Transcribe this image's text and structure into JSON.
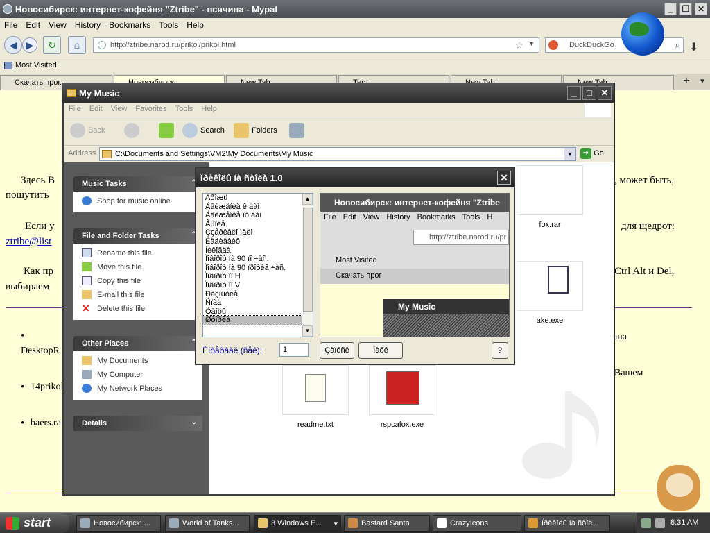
{
  "firefox": {
    "title": "Новосибирск: интернет-кофейня \"Ztribe\" - всячина - Mypal",
    "menu": [
      "File",
      "Edit",
      "View",
      "History",
      "Bookmarks",
      "Tools",
      "Help"
    ],
    "url": "http://ztribe.narod.ru/prikol/prikol.html",
    "search_placeholder": "DuckDuckGo",
    "bookmarks": [
      "Most Visited"
    ],
    "tabs": [
      "Скачать прог...",
      "Новосибирск...",
      "New Tab",
      "Тест...",
      "New Tab",
      "New Tab",
      "New Tab",
      "New Tab"
    ]
  },
  "page": {
    "para1_left": "Здесь В",
    "para1_right": ", может быть,",
    "para1_line2": "пошутить",
    "para2_left": "Если у",
    "para2_right": "для щедрот:",
    "para2_link": "ztribe@list",
    "para3_left": "Как пр",
    "para3_right": "Ctrl Alt и Del,",
    "para3_line2": "выбираем",
    "bullet": "•",
    "item1": "DesktopR",
    "item1_right": "ана",
    "item2": "14prikol",
    "item2_right": "Вашем",
    "item3": "baers.ra"
  },
  "explorer": {
    "title": "My Music",
    "menu": [
      "File",
      "Edit",
      "View",
      "Favorites",
      "Tools",
      "Help"
    ],
    "toolbar": {
      "back": "Back",
      "search": "Search",
      "folders": "Folders"
    },
    "address_label": "Address",
    "address": "C:\\Documents and Settings\\VM2\\My Documents\\My Music",
    "go": "Go",
    "panels": {
      "music_tasks": {
        "title": "Music Tasks",
        "items": [
          "Shop for music online"
        ]
      },
      "file_tasks": {
        "title": "File and Folder Tasks",
        "items": [
          "Rename this file",
          "Move this file",
          "Copy this file",
          "E-mail this file",
          "Delete this file"
        ]
      },
      "other_places": {
        "title": "Other Places",
        "items": [
          "My Documents",
          "My Computer",
          "My Network Places"
        ]
      },
      "details": {
        "title": "Details"
      }
    },
    "files": [
      "fox.rar",
      "ake.exe",
      "readme.txt",
      "rspcafox.exe"
    ]
  },
  "dialog": {
    "title": "Ïðèêîëû íà ñòîëå 1.0",
    "list": [
      "Äðîæü",
      "Äâèæåíèå ê äàì",
      "Äâèæåíèå îò äàì",
      "Âûïèå",
      "Ççåðêàëî ìàëî",
      "Êàäèäàèô",
      "Íèêîãäà",
      "Ïîâîðîò íà 90 ïî ÷àñ.",
      "Ïîâîðîò íà 90 ïðîòèâ ÷àñ.",
      "Ïîâîðîò ïî H",
      "Ïîâîðîò ïî V",
      "Ðàçìûòèå",
      "Ñïàä",
      "Òàíöû",
      "Øòîðêà"
    ],
    "preview_title": "Новосибирск: интернет-кофейня \"Ztribe",
    "preview_menu": [
      "File",
      "Edit",
      "View",
      "History",
      "Bookmarks",
      "Tools",
      "H"
    ],
    "preview_url": "http://ztribe.narod.ru/pr",
    "preview_bm": "Most Visited",
    "preview_tab": "Скачать прог",
    "preview_mm": "My Music",
    "interval_label": "Èíòåðâàë (ñåê):",
    "interval_value": "1",
    "btn_start": "Çàïóñê",
    "btn_stop": "Ïàóé",
    "btn_help": "?"
  },
  "taskbar": {
    "start": "start",
    "tasks": [
      "Новосибирск: ...",
      "World of Tanks...",
      "3 Windows E...",
      "Bastard Santa",
      "CrazyIcons",
      "Ïðèêîëû íà ñòîë..."
    ],
    "clock": "8:31 AM"
  },
  "colors": {
    "page_bg": "#ffffd8",
    "rule": "#7a2a8a",
    "link": "#0000cc"
  }
}
